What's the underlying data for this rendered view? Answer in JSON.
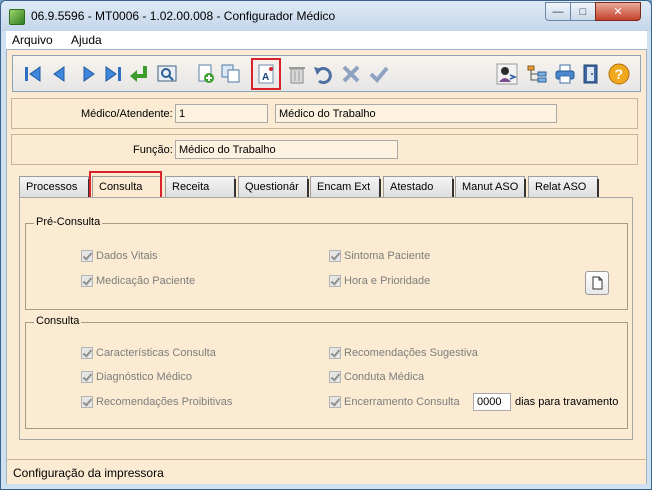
{
  "window": {
    "title": "06.9.5596 - MT0006 - 1.02.00.008 - Configurador Médico",
    "minimize_glyph": "—",
    "maximize_glyph": "□",
    "close_glyph": "✕"
  },
  "menu": {
    "items": [
      "Arquivo",
      "Ajuda"
    ]
  },
  "toolbar": {
    "icons": [
      "first-record-icon",
      "previous-record-icon",
      "next-record-icon",
      "last-record-icon",
      "return-icon",
      "preview-icon",
      "add-icon",
      "copy-icon",
      "print-settings-icon",
      "delete-icon",
      "undo-icon",
      "cancel-icon",
      "confirm-icon",
      "user-icon",
      "tree-icon",
      "printer-icon",
      "exit-icon",
      "help-icon"
    ],
    "help_glyph": "?"
  },
  "header": {
    "medico_label": "Médico/Atendente:",
    "medico_code": "1",
    "medico_name": "Médico do Trabalho",
    "funcao_label": "Função:",
    "funcao_value": "Médico do Trabalho"
  },
  "tabs": [
    "Processos",
    "Consulta",
    "Receita",
    "Questionár",
    "Encam Ext",
    "Atestado",
    "Manut ASO",
    "Relat ASO"
  ],
  "active_tab": "Consulta",
  "pre_consulta": {
    "title": "Pré-Consulta",
    "dados_vitais": "Dados Vitais",
    "medicacao_paciente": "Medicação Paciente",
    "sintoma_paciente": "Sintoma Paciente",
    "hora_prioridade": "Hora e Prioridade"
  },
  "consulta": {
    "title": "Consulta",
    "caracteristicas": "Características Consulta",
    "diagnostico": "Diagnóstico Médico",
    "recomendacoes_proibitivas": "Recomendações Proibitivas",
    "recomendacoes_sugestiva": "Recomendações Sugestiva",
    "conduta_medica": "Conduta Médica",
    "encerramento": "Encerramento Consulta",
    "dias_value": "0000",
    "dias_label": "dias para travamento"
  },
  "status": {
    "text": "Configuração da impressora"
  }
}
